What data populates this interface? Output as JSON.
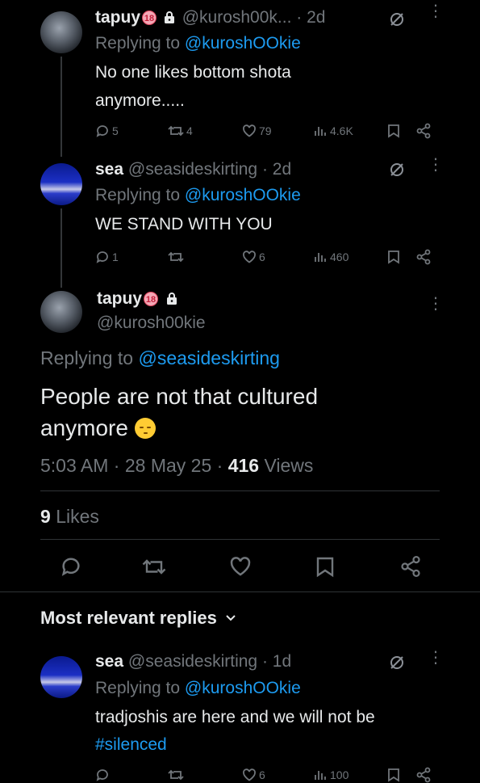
{
  "tweet1": {
    "name": "tapuy",
    "age_badge": "18",
    "handle": "@kurosh00k...",
    "time": "· 2d",
    "replying_prefix": "Replying to",
    "replying_handle": "@kuroshOOkie",
    "text_line1": "No one likes bottom shota",
    "text_line2": "anymore.....",
    "stats": {
      "replies": "5",
      "reposts": "4",
      "likes": "79",
      "views": "4.6K"
    }
  },
  "tweet2": {
    "name": "sea",
    "handle": "@seasideskirting",
    "time": "· 2d",
    "replying_prefix": "Replying to",
    "replying_handle": "@kuroshOOkie",
    "text_line1": "WE STAND WITH YOU",
    "stats": {
      "replies": "1",
      "reposts": "",
      "likes": "6",
      "views": "460"
    }
  },
  "main_tweet": {
    "name": "tapuy",
    "age_badge": "18",
    "handle": "@kurosh00kie",
    "replying_prefix": "Replying to",
    "replying_handle": "@seasideskirting",
    "text_line1": "People are not that cultured",
    "text_line2": "anymore",
    "time": "5:03 AM",
    "date": "28 May 25",
    "views_count": "416",
    "views_label": "Views",
    "likes_count": "9",
    "likes_label": "Likes"
  },
  "section_title": "Most relevant replies",
  "reply3": {
    "name": "sea",
    "handle": "@seasideskirting",
    "time": "· 1d",
    "replying_prefix": "Replying to",
    "replying_handle": "@kuroshOOkie",
    "text_line1": "tradjoshis are here and we will not be",
    "hashtag": "#silenced",
    "stats": {
      "replies": "",
      "reposts": "",
      "likes": "6",
      "views": "100"
    }
  },
  "colors": {
    "background": "#000000",
    "accent": "#1d9bf0",
    "muted": "#71767b",
    "text": "#e7e9ea"
  }
}
